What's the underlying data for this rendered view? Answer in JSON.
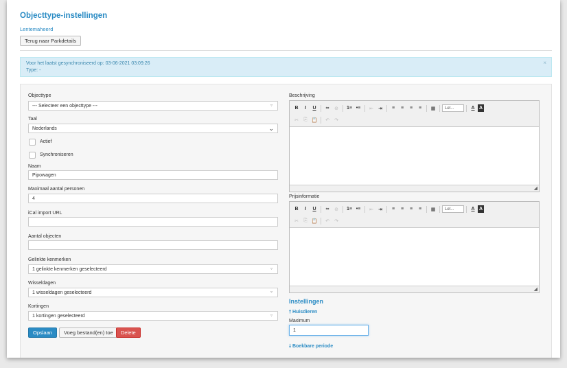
{
  "header": {
    "title": "Objecttype-instellingen",
    "subtitle": "Lentemaheerd",
    "back_button": "Terug naar Parkdetails"
  },
  "alert": {
    "line1": "Voor het laatst gesynchroniseerd op: 03-06-2021 03:09:26",
    "line2": "Type: -",
    "close": "×"
  },
  "form": {
    "objecttype": {
      "label": "Objecttype",
      "value": "--- Selecteer een objecttype ---"
    },
    "taal": {
      "label": "Taal",
      "value": "Nederlands"
    },
    "actief": {
      "label": "Actief"
    },
    "synchroniseren": {
      "label": "Synchroniseren"
    },
    "naam": {
      "label": "Naam",
      "value": "Pipowagen"
    },
    "max_personen": {
      "label": "Maximaal aantal personen",
      "value": "4"
    },
    "ical": {
      "label": "iCal import URL",
      "value": ""
    },
    "aantal_objecten": {
      "label": "Aantal objecten",
      "value": ""
    },
    "kenmerken": {
      "label": "Gelinkte kenmerken",
      "value": "1 gelinkte kenmerken geselecteerd"
    },
    "wisseldagen": {
      "label": "Wisseldagen",
      "value": "1 wisseldagen geselecteerd"
    },
    "kortingen": {
      "label": "Kortingen",
      "value": "1 kortingen geselecteerd"
    }
  },
  "buttons": {
    "save": "Opslaan",
    "add_files": "Voeg bestand(en) toe",
    "delete": "Delete"
  },
  "editors": {
    "beschrijving": "Beschrijving",
    "prijsinformatie": "Prijsinformatie",
    "font_combo": "Let...",
    "toolbar_row1": [
      "B",
      "I",
      "U",
      "∞",
      "⊘",
      "1≡",
      "•≡",
      "⇤",
      "⇥",
      "≡",
      "≡",
      "≡",
      "≡",
      "▦"
    ],
    "toolbar_colors": [
      "A",
      "A"
    ],
    "toolbar_row2": [
      "✂",
      "⎘",
      "📋",
      "↶",
      "↷"
    ]
  },
  "instellingen": {
    "title": "Instellingen",
    "huisdieren": "Huisdieren",
    "maximum_label": "Maximum",
    "maximum_value": "1",
    "boekbare": "Boekbare periode",
    "arrow_up": "🠕",
    "arrow_down": "🠗"
  },
  "colors": {
    "accent": "#2a8bc4",
    "danger": "#d9534f",
    "alert_bg": "#d9edf7"
  }
}
